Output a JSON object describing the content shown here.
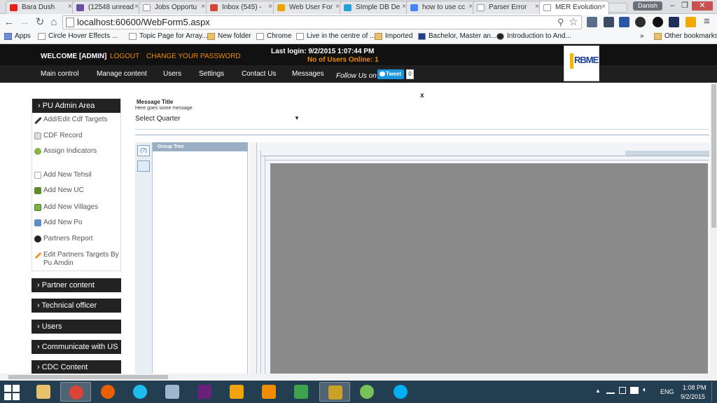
{
  "browser": {
    "tabs": [
      {
        "title": "Bara Dush",
        "color": "#e62117"
      },
      {
        "title": "(12548 unread",
        "color": "#6a4ea8"
      },
      {
        "title": "Jobs Opportu",
        "color": "#ffffff"
      },
      {
        "title": "Inbox (545) -",
        "color": "#d14836"
      },
      {
        "title": "Web User For",
        "color": "#e8a400"
      },
      {
        "title": "SImple DB De",
        "color": "#2aa0d8"
      },
      {
        "title": "how to use cc",
        "color": "#4285f4"
      },
      {
        "title": "Parser Error",
        "color": "#ffffff"
      },
      {
        "title": "MER Evolution",
        "color": "#ffffff"
      }
    ],
    "profile_name": "Danish",
    "url": "localhost:60600/WebForm5.aspx",
    "bookmarks": [
      {
        "label": "Apps"
      },
      {
        "label": "Circle Hover Effects ..."
      },
      {
        "label": "Topic Page for Array..."
      },
      {
        "label": "New folder"
      },
      {
        "label": "Chrome"
      },
      {
        "label": "Live in the centre of ..."
      },
      {
        "label": "Imported"
      },
      {
        "label": "Bachelor, Master an..."
      },
      {
        "label": "Introduction to And..."
      }
    ],
    "overflow": "»",
    "other_bookmarks": "Other bookmarks"
  },
  "header": {
    "welcome": "WELCOME [ADMIN]",
    "logout": "LOGOUT",
    "change_password": "CHANGE YOUR PASSWORD",
    "last_login_label": "Last login: 9/2/2015 1:07:44 PM",
    "online_label": "No of Users Online: 1",
    "logo_text": "RBME",
    "menu": [
      "Main control",
      "Manage content",
      "Users",
      "Settings",
      "Contact Us",
      "Messages"
    ],
    "follow_us": "Follow Us on",
    "tweet_label": "Tweet",
    "tweet_count": "0"
  },
  "sidebar": {
    "admin_title": "› PU Admin Area",
    "items": [
      "Add/Edit Cdf Targets",
      "CDF Record",
      "Assign Indicators",
      "Add New Tehsil",
      "Add New UC",
      "Add New Villages",
      "Add New Po",
      "Partners Report",
      "Edit Partners Targets By Pu Amdin"
    ],
    "sections": [
      "› Partner content",
      "› Technical officer",
      "› Users",
      "› Communicate with US",
      "› CDC Content"
    ]
  },
  "main": {
    "close": "x",
    "message_title": "Message Title",
    "message_body": "Here goes some message",
    "quarter_label": "Select Quarter:",
    "quarter_caret": "▼",
    "group_tree_label": "Group Tree",
    "toggle_icon_label": "(?)"
  },
  "taskbar": {
    "lang": "ENG",
    "time": "1:08 PM",
    "date": "9/2/2015",
    "tray_up": "▲"
  }
}
